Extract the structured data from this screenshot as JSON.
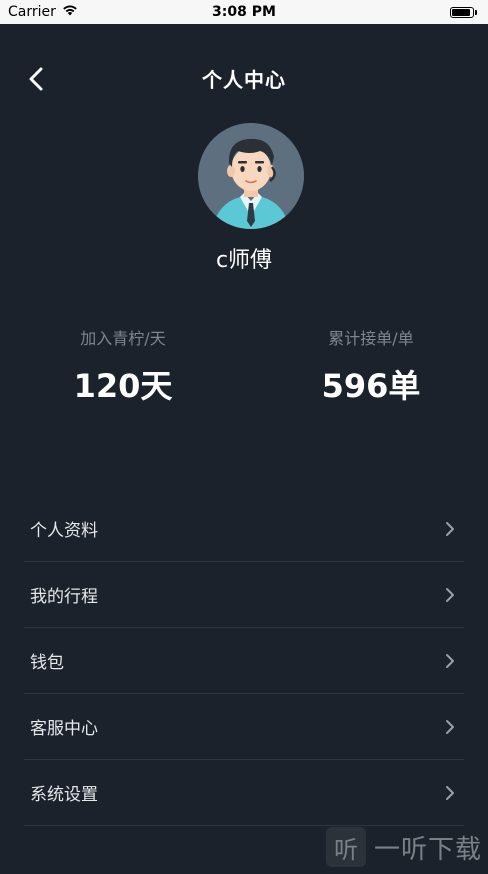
{
  "status_bar": {
    "carrier": "Carrier",
    "time": "3:08 PM",
    "battery_level": 0.9
  },
  "nav": {
    "title": "个人中心",
    "back_icon": "chevron-left-icon"
  },
  "profile": {
    "name": "c师傅"
  },
  "stats": [
    {
      "label": "加入青柠/天",
      "value": "120天"
    },
    {
      "label": "累计接单/单",
      "value": "596单"
    }
  ],
  "menu": {
    "items": [
      {
        "label": "个人资料"
      },
      {
        "label": "我的行程"
      },
      {
        "label": "钱包"
      },
      {
        "label": "客服中心"
      },
      {
        "label": "系统设置"
      }
    ]
  },
  "watermark": {
    "icon_text": "听",
    "text": "一听下载"
  },
  "colors": {
    "background": "#1b222b",
    "divider": "#2c3540",
    "muted_text": "#7d8590"
  }
}
